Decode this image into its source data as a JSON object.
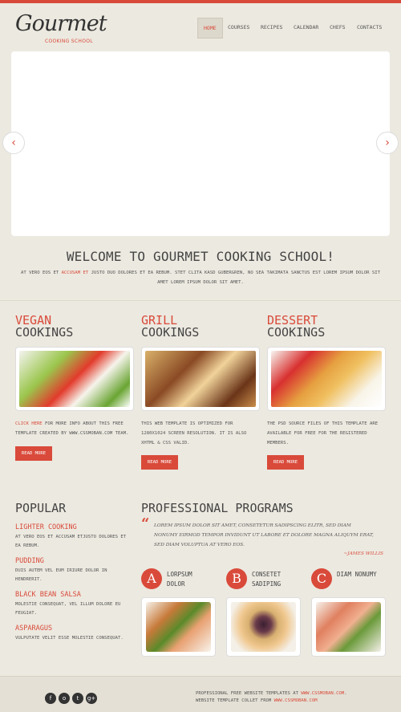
{
  "logo": {
    "name": "Gourmet",
    "tagline": "COOKING SCHOOL"
  },
  "nav": [
    {
      "label": "HOME",
      "active": true
    },
    {
      "label": "COURSES"
    },
    {
      "label": "RECIPES"
    },
    {
      "label": "CALENDAR"
    },
    {
      "label": "CHEFS"
    },
    {
      "label": "CONTACTS"
    }
  ],
  "slider": {
    "prev_icon": "chevron-left-icon",
    "next_icon": "chevron-right-icon"
  },
  "welcome": {
    "title": "WELCOME TO GOURMET COOKING SCHOOL!",
    "intro_pre": "AT VERO EOS ET ",
    "intro_link": "ACCUSAM ET",
    "intro_post": " JUSTO DUO DOLORES ET EA REBUM. STET CLITA KASD GUBERGREN, NO SEA TAKIMATA SANCTUS EST LOREM IPSUM DOLOR SIT AMET LOREM IPSUM DOLOR SIT AMET."
  },
  "features": [
    {
      "title1": "VEGAN",
      "title2": "COOKINGS",
      "text_link": "CLICK HERE",
      "text": " FOR MORE INFO ABOUT THIS FREE TEMPLATE CREATED BY WWW.CSSMOBAN.COM TEAM.",
      "button": "READ MORE"
    },
    {
      "title1": "GRILL",
      "title2": "COOKINGS",
      "text_link": "",
      "text": "THIS WEB TEMPLATE IS OPTIMIZED FOR 1280X1024 SCREEN RESOLUTION. IT IS ALSO XHTML & CSS VALID.",
      "button": "READ MORE"
    },
    {
      "title1": "DESSERT",
      "title2": "COOKINGS",
      "text_link": "",
      "text": "THE PSD SOURCE FILES OF THIS TEMPLATE ARE AVAILABLE FOR FREE FOR THE REGISTERED MEMBERS.",
      "button": "READ MORE"
    }
  ],
  "popular": {
    "title": "POPULAR",
    "items": [
      {
        "heading": "LIGHTER COOKING",
        "text": "AT VERO EOS ET ACCUSAM ETJUSTO DOLORES ET EA REBUM."
      },
      {
        "heading": "PUDDING",
        "text": "DUIS AUTEM VEL EUM IRIURE DOLOR IN HENDRERIT."
      },
      {
        "heading": "BLACK BEAN SALSA",
        "text": "MOLESTIE CONSEQUAT, VEL ILLUM DOLORE EU FEUGIAT."
      },
      {
        "heading": "ASPARAGUS",
        "text": "VULPUTATE VELIT ESSE MOLESTIE CONSEQUAT."
      }
    ]
  },
  "programs": {
    "title": "PROFESSIONAL PROGRAMS",
    "quote": "LOREM IPSUM DOLOR SIT AMET, CONSETETUR SADIPSCING ELITR, SED DIAM NONUMY EIRMOD TEMPOR INVIDUNT UT LABORE ET DOLORE MAGNA ALIQUYM ERAT, SED DIAM VOLUPTUA AT VERO EOS.",
    "author": "~JAMES WILLIS",
    "cards": [
      {
        "letter": "A",
        "label1": "LORPSUM",
        "label2": "DOLOR"
      },
      {
        "letter": "B",
        "label1": "CONSETET",
        "label2": "SADIPING"
      },
      {
        "letter": "C",
        "label1": "DIAM NONUMY",
        "label2": ""
      }
    ]
  },
  "footer": {
    "social": [
      "f",
      "o",
      "t",
      "g+"
    ],
    "line1_pre": "PROFESSIONAL FREE WEBSITE TEMPLATES AT ",
    "line1_link": "WWW.CSSMOBAN.COM",
    "line1_post": ".",
    "line2_pre": "WEBSITE TEMPLATE COLLET FROM ",
    "line2_link": "WWW.CSSMOBAN.COM"
  },
  "colors": {
    "accent": "#d94a3a",
    "background": "#ece9e0"
  }
}
